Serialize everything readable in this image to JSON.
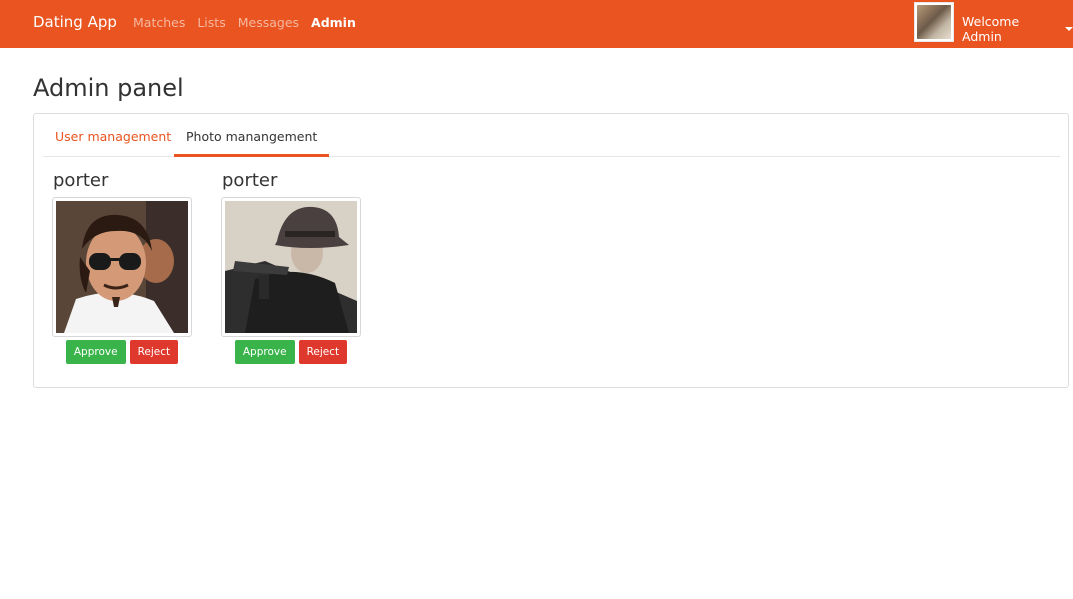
{
  "nav": {
    "brand": "Dating App",
    "links": [
      "Matches",
      "Lists",
      "Messages",
      "Admin"
    ],
    "welcome": "Welcome Admin"
  },
  "page": {
    "title": "Admin panel"
  },
  "tabs": [
    "User management",
    "Photo manangement"
  ],
  "photos": [
    {
      "username": "porter",
      "approve": "Approve",
      "reject": "Reject"
    },
    {
      "username": "porter",
      "approve": "Approve",
      "reject": "Reject"
    }
  ],
  "colors": {
    "primary": "#e95420",
    "success": "#38b44a",
    "danger": "#df382c"
  }
}
